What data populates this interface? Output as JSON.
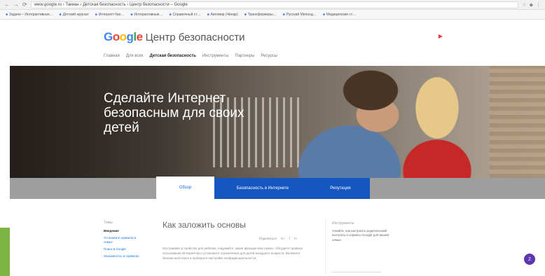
{
  "browser": {
    "address": "www.google.ru › Такиан › Детская безопасность › Центр безопасности – Google",
    "bookmarks": [
      "Задачи – Интерактивная…",
      "Детский журнал",
      "Интернет-бан…",
      "Интерактивные…",
      "Справочный ст…",
      "Автомир (Чинар)",
      "Трансформеры…",
      "Русский Мелонд…",
      "Медицинские ст…"
    ]
  },
  "header": {
    "logo": {
      "g1": "G",
      "o1": "o",
      "o2": "o",
      "g2": "g",
      "l": "l",
      "e": "e"
    },
    "title": "Центр безопасности",
    "nav": [
      "Главная",
      "Для всех",
      "Детская безопасность",
      "Инструменты",
      "Партнеры",
      "Ресурсы"
    ]
  },
  "hero": {
    "heading": "Сделайте Интернет безопасным для своих детей"
  },
  "tabs": {
    "overview": "Обзор",
    "internet": "Безопасность в Интернете",
    "reputation": "Репутация"
  },
  "sidebar": {
    "heading": "Темы",
    "items": [
      "Введение",
      "Установите правила в семье",
      "Поиск в Google",
      "Знакомьтесь в сервисах"
    ]
  },
  "article": {
    "title": "Как заложить основы",
    "share": [
      "Поделиться",
      "G+",
      "f",
      "in"
    ],
    "text": "Настраивая устройство для ребенка, подумайте, какие функции ему нужны. Обсудите правила пользования Интернетом и установите ограничения для детей младшего возраста. Включите безопасный поиск и проверьте настройки конфиденциальности."
  },
  "tools": {
    "heading": "Инструменты",
    "text": "Узнайте, как настроить родительский контроль и сервисы Google для вашей семьи"
  },
  "colors": {
    "accent": "#1557c0",
    "fab": "#5e35b1",
    "side": "#7cb342"
  },
  "fab": {
    "label": "2"
  }
}
